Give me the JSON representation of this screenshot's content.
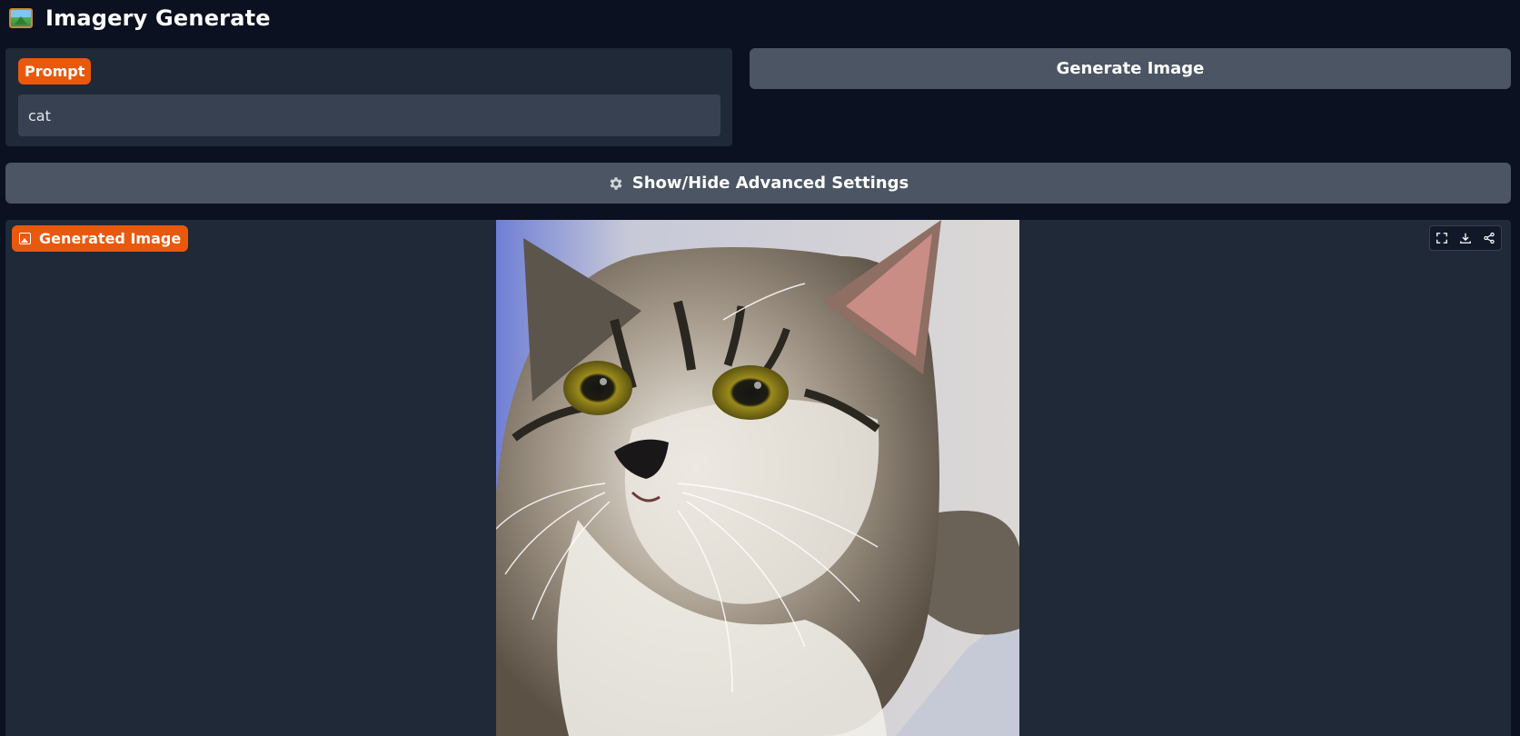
{
  "app": {
    "title": "Imagery Generate",
    "logo_icon": "framed-picture-icon"
  },
  "prompt": {
    "label": "Prompt",
    "value": "cat"
  },
  "actions": {
    "generate_label": "Generate Image",
    "advanced_label": "Show/Hide Advanced Settings",
    "advanced_icon": "gear-icon"
  },
  "output": {
    "label": "Generated Image",
    "label_icon": "image-icon",
    "image_subject": "cat",
    "toolbar": [
      "fullscreen-icon",
      "download-icon",
      "share-icon"
    ]
  },
  "colors": {
    "background": "#0b1120",
    "panel": "#1f2937",
    "input": "#374151",
    "button": "#4b5563",
    "accent": "#ea580c"
  }
}
